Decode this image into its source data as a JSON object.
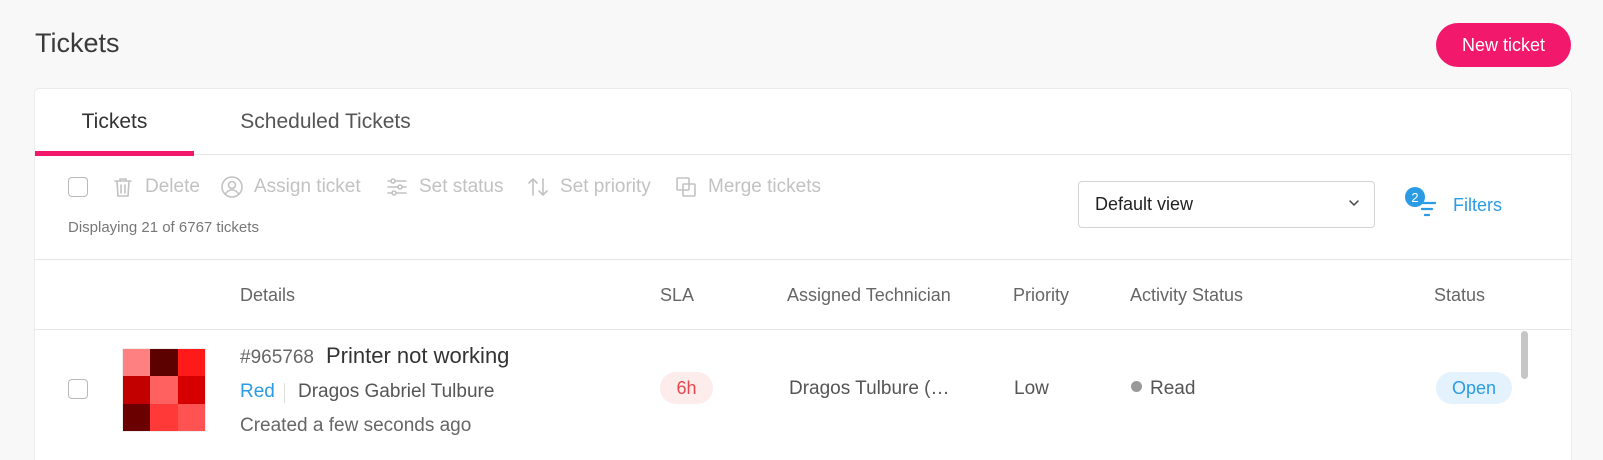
{
  "page": {
    "title": "Tickets",
    "new_ticket_label": "New ticket"
  },
  "tabs": [
    {
      "label": "Tickets",
      "active": true
    },
    {
      "label": "Scheduled Tickets",
      "active": false
    }
  ],
  "toolbar": {
    "actions": [
      {
        "label": "Delete",
        "icon": "trash-icon"
      },
      {
        "label": "Assign ticket",
        "icon": "user-circle-icon"
      },
      {
        "label": "Set status",
        "icon": "sliders-icon"
      },
      {
        "label": "Set priority",
        "icon": "sort-arrows-icon"
      },
      {
        "label": "Merge tickets",
        "icon": "merge-icon"
      }
    ],
    "display_count": "Displaying 21 of 6767 tickets",
    "view_select": "Default view",
    "filters_label": "Filters",
    "filters_count": "2"
  },
  "columns": [
    "Details",
    "SLA",
    "Assigned Technician",
    "Priority",
    "Activity Status",
    "Status"
  ],
  "rows": [
    {
      "number": "#965768",
      "title": "Printer not working",
      "team": "Red",
      "requester": "Dragos Gabriel Tulbure",
      "created": "Created a few seconds ago",
      "sla": "6h",
      "technician": "Dragos Tulbure (…",
      "priority": "Low",
      "activity": "Read",
      "status": "Open",
      "thumb_colors": [
        "#ff8080",
        "#5c0000",
        "#ff1a1a",
        "#c20000",
        "#ff6161",
        "#d60000",
        "#6b0000",
        "#ff3838",
        "#ff5252"
      ]
    }
  ],
  "colors": {
    "accent": "#f2186c",
    "link": "#2b9be3",
    "sla_text": "#e5484d"
  }
}
